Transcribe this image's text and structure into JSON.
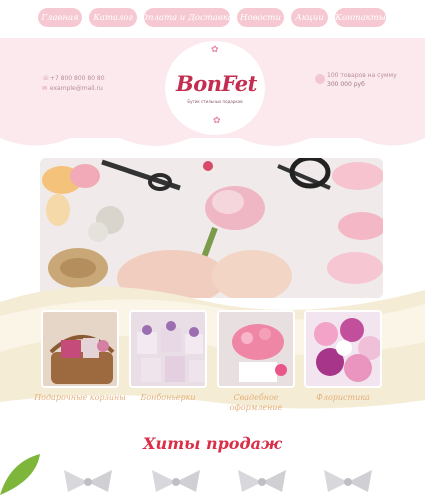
{
  "nav": {
    "items": [
      "Главная",
      "Каталог",
      "Оплата и Доставка",
      "Новости",
      "Акции",
      "Контакты"
    ]
  },
  "header": {
    "phone": "+7 800 800 80 80",
    "email": "example@mail.ru",
    "logo_text": "BonFet",
    "logo_subtitle": "Бутик стильных подарков",
    "cart_line1": "100 товаров на сумму",
    "cart_line2": "300 000 руб"
  },
  "categories": [
    {
      "label": "Подарочные корзины"
    },
    {
      "label": "Бонбоньерки"
    },
    {
      "label": "Свадебное оформление"
    },
    {
      "label": "Флористика"
    }
  ],
  "hits": {
    "title": "Хиты продаж"
  },
  "colors": {
    "pill": "#f6c9d2",
    "band": "#fbe9ed",
    "logo_red": "#c42d4f",
    "category_label": "#e3b07a",
    "hits_title": "#d92f48"
  }
}
